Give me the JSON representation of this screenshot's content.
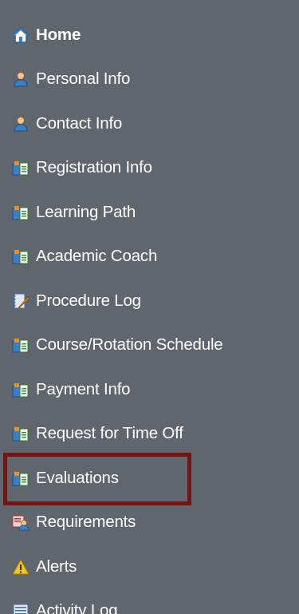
{
  "nav": {
    "items": [
      {
        "label": "Home",
        "icon": "home-icon"
      },
      {
        "label": "Personal Info",
        "icon": "person-icon"
      },
      {
        "label": "Contact Info",
        "icon": "person-icon"
      },
      {
        "label": "Registration Info",
        "icon": "folder-document-icon"
      },
      {
        "label": "Learning Path",
        "icon": "folder-document-icon"
      },
      {
        "label": "Academic Coach",
        "icon": "folder-document-icon"
      },
      {
        "label": "Procedure Log",
        "icon": "notepad-pencil-icon"
      },
      {
        "label": "Course/Rotation Schedule",
        "icon": "folder-document-icon"
      },
      {
        "label": "Payment Info",
        "icon": "folder-document-icon"
      },
      {
        "label": "Request for Time Off",
        "icon": "folder-document-icon"
      },
      {
        "label": "Evaluations",
        "icon": "folder-document-icon"
      },
      {
        "label": "Requirements",
        "icon": "user-card-icon"
      },
      {
        "label": "Alerts",
        "icon": "warning-icon"
      },
      {
        "label": "Activity Log",
        "icon": "log-icon"
      }
    ],
    "highlighted_item": "Evaluations"
  },
  "colors": {
    "sidebar_background": "#5f666d",
    "text": "#ffffff",
    "highlight_border": "#7a1412"
  }
}
